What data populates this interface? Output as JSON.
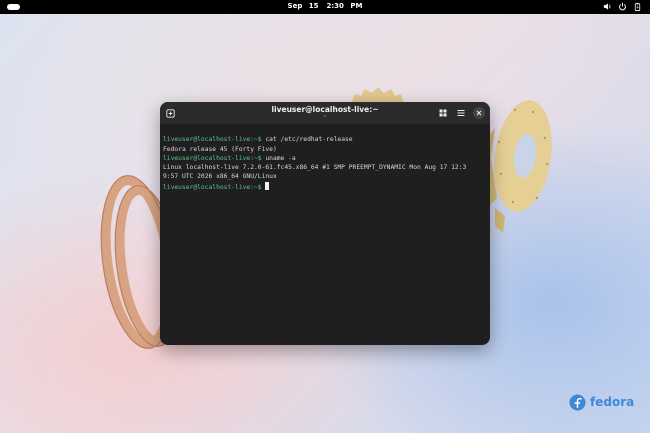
{
  "topbar": {
    "date": "Sep 15",
    "time": "2:30 PM",
    "icons": [
      "volume-icon",
      "power-icon",
      "battery-icon"
    ]
  },
  "terminal": {
    "title": "liveuser@localhost-live:~",
    "subtitle": "~",
    "lines": [
      {
        "prompt": "liveuser@localhost-live:~$",
        "text": " cat /etc/redhat-release"
      },
      {
        "prompt": "",
        "text": "Fedora release 45 (Forty Five)"
      },
      {
        "prompt": "liveuser@localhost-live:~$",
        "text": " uname -a"
      },
      {
        "prompt": "",
        "text": "Linux localhost-live 7.2.0-61.fc45.x86_64 #1 SMP PREEMPT_DYNAMIC Mon Aug 17 12:3"
      },
      {
        "prompt": "",
        "text": "9:57 UTC 2026 x86_64 GNU/Linux"
      },
      {
        "prompt": "liveuser@localhost-live:~$",
        "text": " "
      }
    ]
  },
  "brand": {
    "wordmark": "fedora",
    "color": "#3f88d8"
  },
  "colors": {
    "prompt": "#57c78a",
    "terminal_bg": "#1f1f1f",
    "header_bg": "#2b2b2b"
  }
}
